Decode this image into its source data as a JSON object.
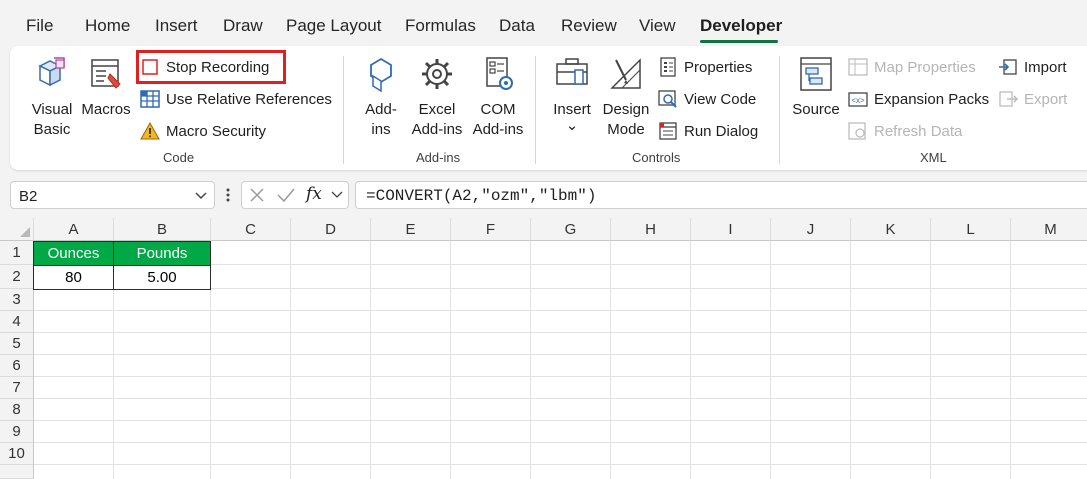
{
  "menu": {
    "tabs": [
      "File",
      "Home",
      "Insert",
      "Draw",
      "Page Layout",
      "Formulas",
      "Data",
      "Review",
      "View",
      "Developer"
    ],
    "active": "Developer"
  },
  "ribbon": {
    "code": {
      "visual_basic": [
        "Visual",
        "Basic"
      ],
      "macros": "Macros",
      "stop_recording": "Stop Recording",
      "relative_refs": "Use Relative References",
      "macro_security": "Macro Security",
      "group_label": "Code"
    },
    "addins": {
      "addins": [
        "Add-",
        "ins"
      ],
      "excel_addins": [
        "Excel",
        "Add-ins"
      ],
      "com_addins": [
        "COM",
        "Add-ins"
      ],
      "group_label": "Add-ins"
    },
    "controls": {
      "insert": "Insert",
      "insert_chevron": "⌄",
      "design_mode": [
        "Design",
        "Mode"
      ],
      "properties": "Properties",
      "view_code": "View Code",
      "run_dialog": "Run Dialog",
      "group_label": "Controls"
    },
    "xml": {
      "source": "Source",
      "map_properties": "Map Properties",
      "expansion_packs": "Expansion Packs",
      "refresh_data": "Refresh Data",
      "import": "Import",
      "export": "Export",
      "group_label": "XML"
    }
  },
  "formula_bar": {
    "name_box": "B2",
    "formula": "=CONVERT(A2,\"ozm\",\"lbm\")",
    "fx_label": "fx"
  },
  "sheet": {
    "columns": [
      "A",
      "B",
      "C",
      "D",
      "E",
      "F",
      "G",
      "H",
      "I",
      "J",
      "K",
      "L",
      "M"
    ],
    "rows": [
      "1",
      "2",
      "3",
      "4",
      "5",
      "6",
      "7",
      "8",
      "9",
      "10"
    ],
    "headers": [
      "Ounces",
      "Pounds"
    ],
    "values": [
      "80",
      "5.00"
    ]
  },
  "colors": {
    "accent": "#117244",
    "header_fill": "#00a846",
    "highlight": "#e0201f"
  }
}
